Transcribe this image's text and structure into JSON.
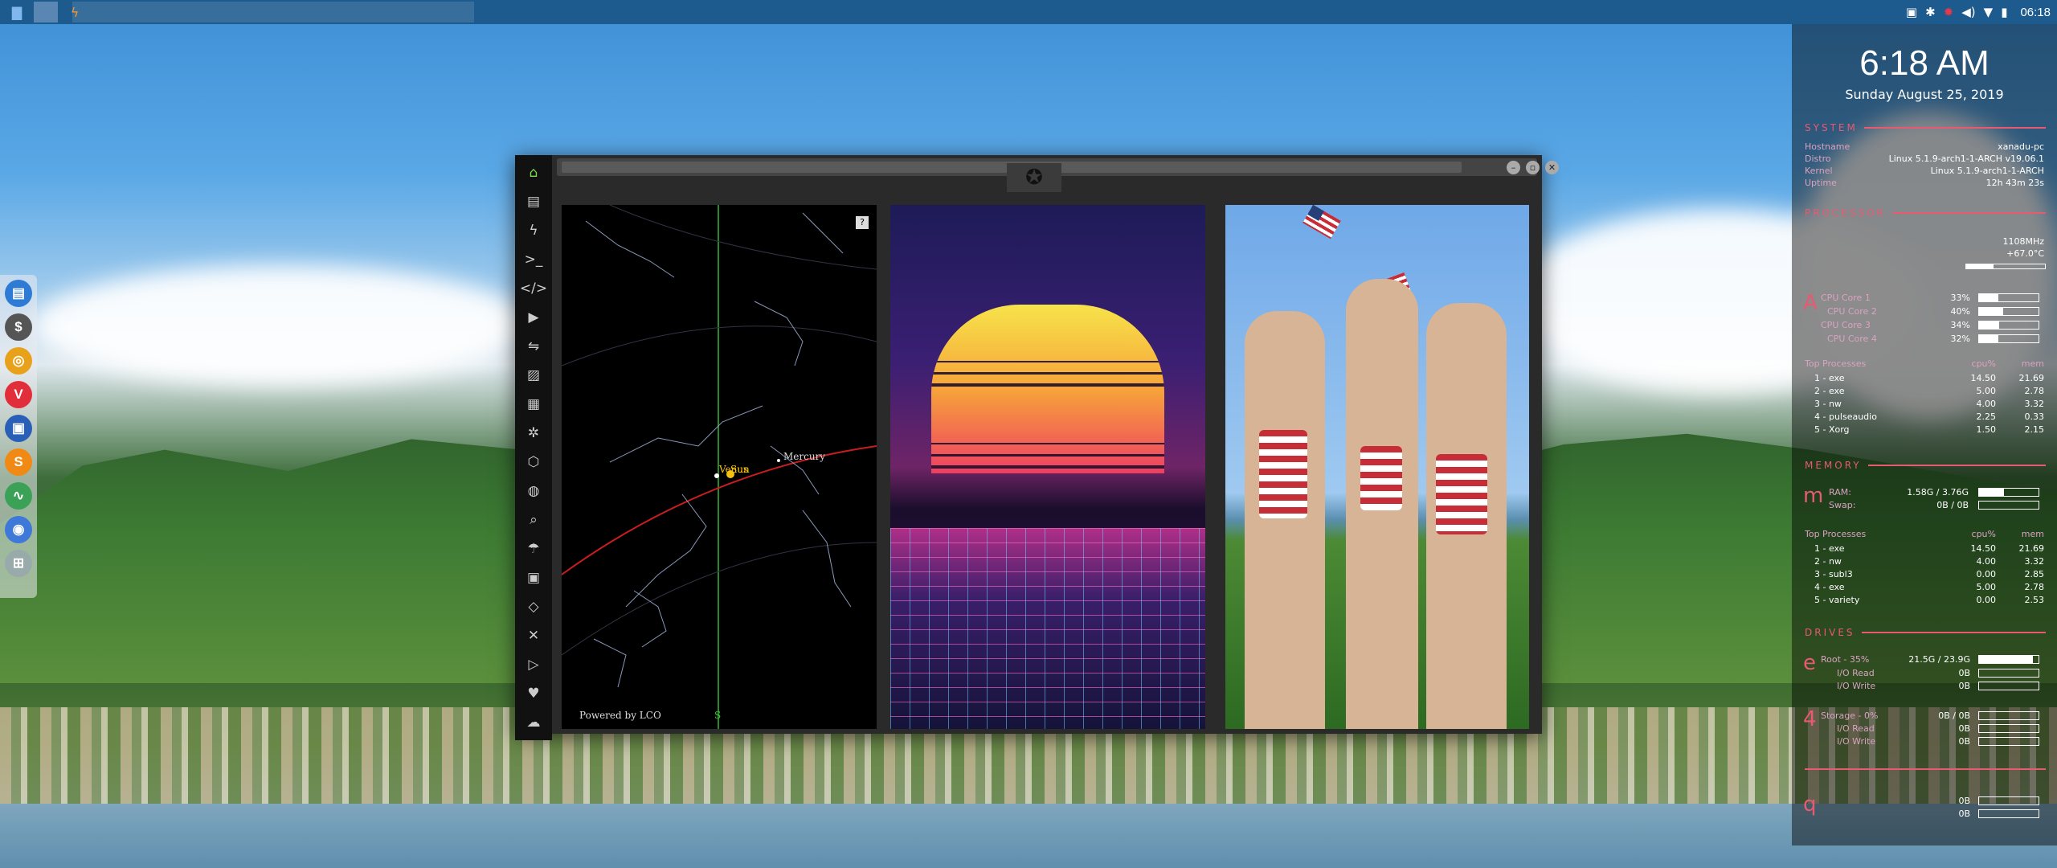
{
  "top_panel": {
    "tray_icons": [
      "screenshot-icon",
      "bluetooth-icon",
      "gear-red-icon",
      "volume-icon",
      "wifi-icon",
      "battery-icon"
    ],
    "clock": "06:18"
  },
  "dock": {
    "apps": [
      {
        "name": "files",
        "glyph": "▤",
        "color": "#2d7bd4"
      },
      {
        "name": "money",
        "glyph": "$",
        "color": "#555"
      },
      {
        "name": "help",
        "glyph": "◎",
        "color": "#e8a11a"
      },
      {
        "name": "vivaldi",
        "glyph": "V",
        "color": "#e22d3a"
      },
      {
        "name": "screen",
        "glyph": "▣",
        "color": "#2a5fb7"
      },
      {
        "name": "sublime",
        "glyph": "S",
        "color": "#f08a14"
      },
      {
        "name": "monitor",
        "glyph": "∿",
        "color": "#3aa157"
      },
      {
        "name": "chrome",
        "glyph": "◉",
        "color": "#3e78d8"
      },
      {
        "name": "grid",
        "glyph": "⊞",
        "color": "#9aa"
      }
    ]
  },
  "window": {
    "emblem": "✪",
    "sidebar": [
      "⌂",
      "▤",
      "ϟ",
      ">_",
      "</>",
      "▶",
      "⇋",
      "▨",
      "▦",
      "✲",
      "⬡",
      "◍",
      "⌕",
      "☂",
      "▣",
      "◇",
      "✕",
      "▷",
      "♥",
      "☁"
    ],
    "planetarium": {
      "help_label": "?",
      "powered_by": "Powered by LCO",
      "sun_label": "Venus",
      "sun_label2": "Sun",
      "mercury_label": "Mercury",
      "compass": "S"
    }
  },
  "conky": {
    "time": "6:18 AM",
    "date": "Sunday August 25, 2019",
    "system": {
      "heading": "SYSTEM",
      "rows": [
        {
          "label": "Hostname",
          "value": "xanadu-pc"
        },
        {
          "label": "Distro",
          "value": "Linux 5.1.9-arch1-1-ARCH v19.06.1"
        },
        {
          "label": "Kernel",
          "value": "Linux 5.1.9-arch1-1-ARCH"
        },
        {
          "label": "Uptime",
          "value": "12h 43m 23s"
        }
      ]
    },
    "processor": {
      "heading": "PROCESSOR",
      "freq": "1108MHz",
      "temp": "+67.0°C",
      "letter": "A",
      "cores": [
        {
          "label": "CPU Core 1",
          "value": "33%",
          "pct": 0.33
        },
        {
          "label": "CPU Core 2",
          "value": "40%",
          "pct": 0.4
        },
        {
          "label": "CPU Core 3",
          "value": "34%",
          "pct": 0.34
        },
        {
          "label": "CPU Core 4",
          "value": "32%",
          "pct": 0.32
        }
      ],
      "top_header": [
        "Top Processes",
        "cpu%",
        "mem"
      ],
      "top": [
        [
          "1 - exe",
          "14.50",
          "21.69"
        ],
        [
          "2 - exe",
          "5.00",
          "2.78"
        ],
        [
          "3 - nw",
          "4.00",
          "3.32"
        ],
        [
          "4 - pulseaudio",
          "2.25",
          "0.33"
        ],
        [
          "5 - Xorg",
          "1.50",
          "2.15"
        ]
      ]
    },
    "memory": {
      "heading": "MEMORY",
      "letter": "m",
      "ram_label": "RAM:",
      "ram": "1.58G / 3.76G",
      "ram_pct": 0.42,
      "swap_label": "Swap:",
      "swap": "0B / 0B",
      "top_header": [
        "Top Processes",
        "cpu%",
        "mem"
      ],
      "top": [
        [
          "1 - exe",
          "14.50",
          "21.69"
        ],
        [
          "2 - nw",
          "4.00",
          "3.32"
        ],
        [
          "3 - subl3",
          "0.00",
          "2.85"
        ],
        [
          "4 - exe",
          "5.00",
          "2.78"
        ],
        [
          "5 - variety",
          "0.00",
          "2.53"
        ]
      ]
    },
    "drives": {
      "heading": "DRIVES",
      "d1_letter": "e",
      "d1_label": "Root - 35%",
      "d1_value": "21.5G / 23.9G",
      "d1_pct": 0.9,
      "d1_read": "I/O Read",
      "d1_read_val": "0B",
      "d1_write": "I/O Write",
      "d1_write_val": "0B",
      "d2_letter": "4",
      "d2_label": "Storage - 0%",
      "d2_value": "0B / 0B",
      "d2_read": "I/O Read",
      "d2_read_val": "0B",
      "d2_write": "I/O Write",
      "d2_write_val": "0B"
    },
    "network": {
      "letter": "q",
      "up_val": "0B",
      "down_val": "0B"
    }
  }
}
